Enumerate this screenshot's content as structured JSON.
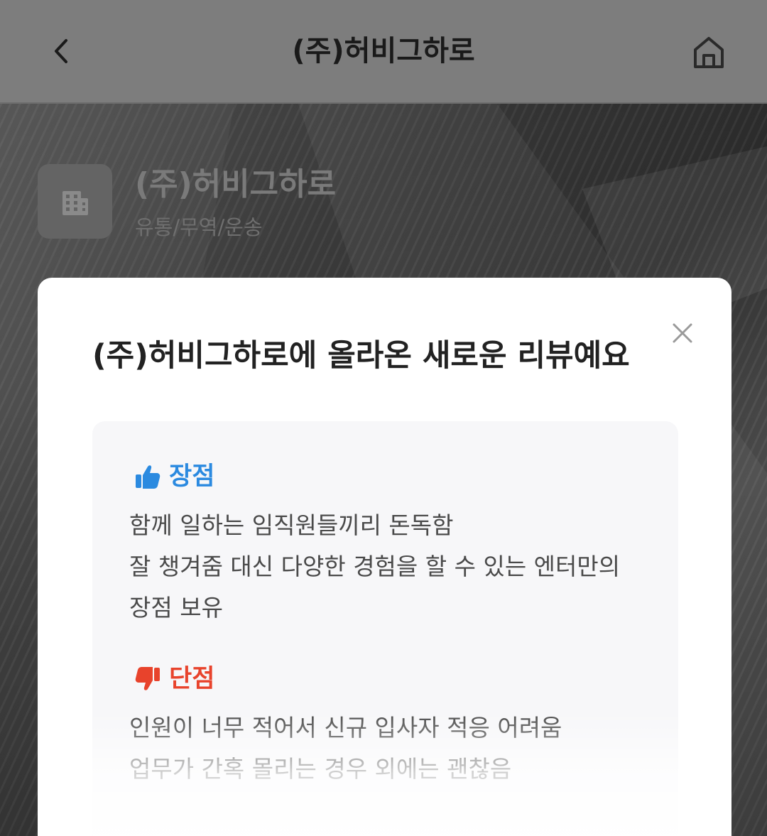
{
  "header": {
    "title": "(주)허비그하로",
    "back_icon": "chevron-left-icon",
    "home_icon": "home-icon"
  },
  "company": {
    "name": "(주)허비그하로",
    "category": "유통/무역/운송",
    "logo_icon": "building-icon"
  },
  "modal": {
    "title": "(주)허비그하로에 올라온 새로운 리뷰예요",
    "close_icon": "close-icon",
    "pros": {
      "label": "장점",
      "icon": "thumbs-up-icon",
      "lines": [
        "함께 일하는 임직원들끼리 돈독함",
        "잘 챙겨줌 대신 다양한 경험을 할 수 있는 엔터만의",
        "장점 보유"
      ]
    },
    "cons": {
      "label": "단점",
      "icon": "thumbs-down-icon",
      "lines": [
        "인원이 너무 적어서 신규 입사자 적응 어려움",
        "업무가 간혹 몰리는 경우 외에는 괜찮음"
      ]
    }
  },
  "colors": {
    "topbar_bg": "#7d7d7d",
    "pros_accent": "#2b8ae0",
    "cons_accent": "#e8432c",
    "card_bg": "#f7f7f9"
  }
}
